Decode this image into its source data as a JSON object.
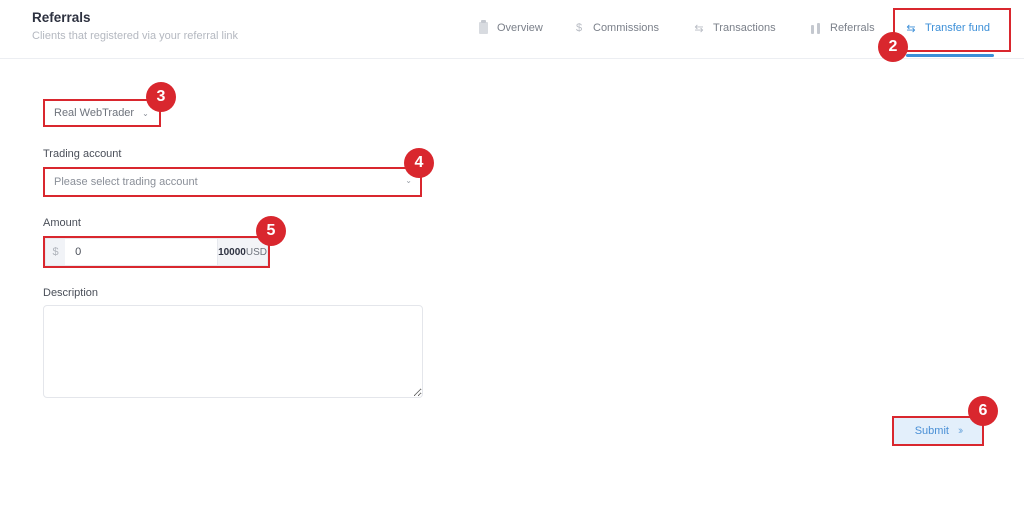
{
  "header": {
    "title": "Referrals",
    "subtitle": "Clients that registered via your referral link"
  },
  "tabs": [
    {
      "label": "Overview",
      "icon": "clipboard-icon",
      "active": false
    },
    {
      "label": "Commissions",
      "icon": "dollar-icon",
      "glyph": "$",
      "active": false
    },
    {
      "label": "Transactions",
      "icon": "exchange-arrows-icon",
      "glyph": "⇆",
      "active": false
    },
    {
      "label": "Referrals",
      "icon": "bar-chart-icon",
      "active": false
    },
    {
      "label": "Transfer fund",
      "icon": "exchange-arrows-icon",
      "glyph": "⇆",
      "active": true
    }
  ],
  "form": {
    "platform_select": {
      "value": "Real WebTrader",
      "chevron": "⌄"
    },
    "trading_account": {
      "label": "Trading account",
      "placeholder": "Please select trading account",
      "chevron": "⌄"
    },
    "amount": {
      "label": "Amount",
      "prefix": "$",
      "value": "0",
      "max_value": "10000",
      "currency": "USD"
    },
    "description": {
      "label": "Description",
      "value": ""
    },
    "submit": {
      "label": "Submit",
      "chevron": "››"
    }
  },
  "annotations": {
    "colors": {
      "annotation_red": "#d9272e",
      "accent_blue": "#3c8fd8"
    },
    "badges": [
      "2",
      "3",
      "4",
      "5",
      "6"
    ]
  }
}
